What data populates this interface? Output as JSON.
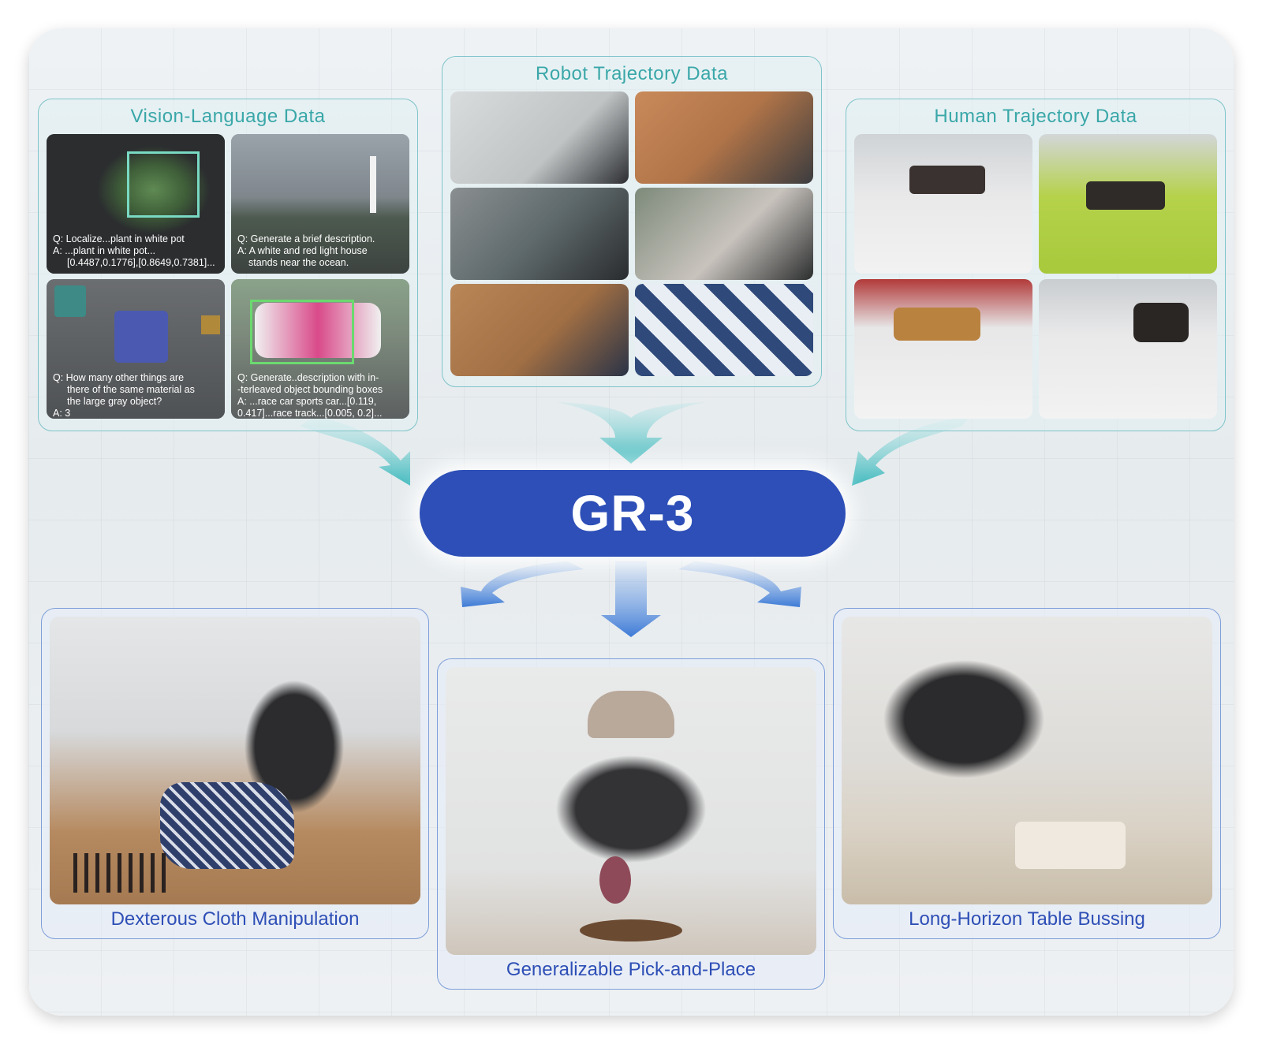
{
  "center": {
    "label": "GR-3"
  },
  "data_sources": {
    "vision_language": {
      "title": "Vision-Language Data",
      "tiles": [
        {
          "q": "Q:  Localize...plant in white pot",
          "a1": "A: ...plant in white pot...",
          "a2": "[0.4487,0.1776],[0.8649,0.7381]..."
        },
        {
          "q": "Q: Generate a brief description.",
          "a1": "A: A white and red light house",
          "a2": "stands near the ocean."
        },
        {
          "q": "Q: How many other things are",
          "q2": "there of the same material as",
          "q3": "the large gray object?",
          "a1": "A: 3"
        },
        {
          "q": "Q: Generate..description with in-",
          "q2": "-terleaved object bounding boxes",
          "a1": "A: ...race car sports car...[0.119,",
          "a2": "0.417]...race track...[0.005, 0.2]..."
        }
      ]
    },
    "robot_trajectory": {
      "title": "Robot Trajectory Data"
    },
    "human_trajectory": {
      "title": "Human Trajectory Data"
    }
  },
  "tasks": {
    "cloth": {
      "label": "Dexterous Cloth Manipulation"
    },
    "pick": {
      "label": "Generalizable Pick-and-Place"
    },
    "bussing": {
      "label": "Long-Horizon Table Bussing"
    }
  },
  "colors": {
    "accent_teal": "#3aa7a8",
    "gr3_blue": "#2d4fb7",
    "task_text": "#2e4fb6",
    "arrow_teal": "#56c7c9",
    "arrow_blue": "#4a86db"
  }
}
